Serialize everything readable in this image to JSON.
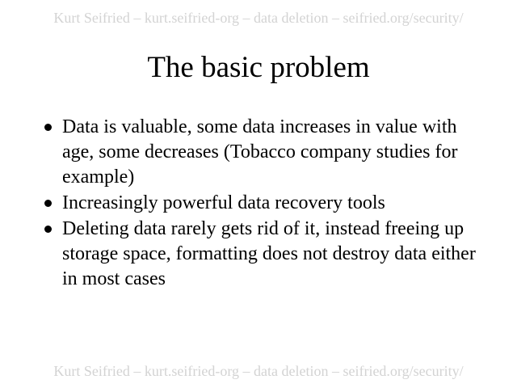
{
  "slide": {
    "header_note": "Kurt Seifried – kurt.seifried-org – data deletion – seifried.org/security/",
    "title": "The basic problem",
    "bullets": [
      "Data is valuable, some data increases in value with age, some decreases (Tobacco company studies for example)",
      "Increasingly powerful data recovery tools",
      "Deleting data rarely gets rid of it, instead freeing up storage space, formatting does not destroy data either in most cases"
    ],
    "footer_note": "Kurt Seifried – kurt.seifried-org – data deletion – seifried.org/security/"
  }
}
